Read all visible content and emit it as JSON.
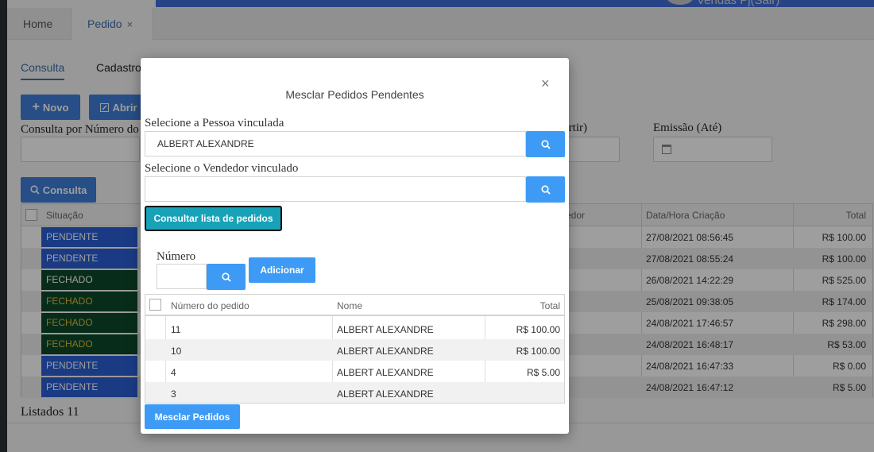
{
  "header": {
    "user_label": "Vendas Pj(Sair)"
  },
  "tabs": [
    {
      "label": "Home"
    },
    {
      "label": "Pedido",
      "close": "×"
    }
  ],
  "subtabs": [
    {
      "label": "Consulta"
    },
    {
      "label": "Cadastro"
    }
  ],
  "toolbar": {
    "novo_label": "Novo",
    "abrir_label": "Abrir",
    "consulta_label": "Consulta"
  },
  "filters": {
    "numero_label": "Consulta por Número do",
    "emissao_partir_label": "artir)",
    "emissao_ate_label": "Emissão (Até)"
  },
  "grid": {
    "columns": {
      "situacao": "Situação",
      "vendedor": "edor",
      "data_hora": "Data/Hora Criação",
      "total": "Total"
    },
    "rows": [
      {
        "situacao": "PENDENTE",
        "status_kind": "pendente",
        "data_hora": "27/08/2021 08:56:45",
        "total": "R$ 100.00"
      },
      {
        "situacao": "PENDENTE",
        "status_kind": "pendente",
        "data_hora": "27/08/2021 08:55:24",
        "total": "R$ 100.00"
      },
      {
        "situacao": "FECHADO",
        "status_kind": "fechado",
        "data_hora": "26/08/2021 14:22:29",
        "total": "R$ 525.00"
      },
      {
        "situacao": "FECHADO",
        "status_kind": "fechado-y",
        "data_hora": "25/08/2021 09:38:05",
        "total": "R$ 174.00"
      },
      {
        "situacao": "FECHADO",
        "status_kind": "fechado-y",
        "data_hora": "24/08/2021 17:46:57",
        "total": "R$ 298.00"
      },
      {
        "situacao": "FECHADO",
        "status_kind": "fechado-y",
        "data_hora": "24/08/2021 16:48:17",
        "total": "R$ 53.00"
      },
      {
        "situacao": "PENDENTE",
        "status_kind": "pendente",
        "data_hora": "24/08/2021 16:47:33",
        "total": "R$ 0.00"
      },
      {
        "situacao": "PENDENTE",
        "status_kind": "pendente",
        "data_hora": "24/08/2021 16:47:12",
        "total": "R$ 5.00"
      }
    ],
    "listed_label": "Listados 11"
  },
  "modal": {
    "title": "Mesclar Pedidos Pendentes",
    "close": "×",
    "pessoa_label": "Selecione a Pessoa vinculada",
    "pessoa_value": "ALBERT ALEXANDRE",
    "vendedor_label": "Selecione o Vendedor vinculado",
    "vendedor_value": "",
    "consultar_label": "Consultar lista de pedidos",
    "numero_label": "Número",
    "numero_value": "",
    "adicionar_label": "Adicionar",
    "table": {
      "columns": {
        "numero": "Número do pedido",
        "nome": "Nome",
        "total": "Total"
      },
      "rows": [
        {
          "numero": "11",
          "nome": "ALBERT ALEXANDRE",
          "total": "R$ 100.00"
        },
        {
          "numero": "10",
          "nome": "ALBERT ALEXANDRE",
          "total": "R$ 100.00"
        },
        {
          "numero": "4",
          "nome": "ALBERT ALEXANDRE",
          "total": "R$ 5.00"
        },
        {
          "numero": "3",
          "nome": "ALBERT ALEXANDRE",
          "total": ""
        }
      ]
    },
    "mesclar_label": "Mesclar Pedidos"
  },
  "colors": {
    "primary": "#3f7fd8",
    "modal_button": "#3d9bf5",
    "teal_button": "#17a2b8",
    "pendente": "#2a5fd6",
    "fechado": "#0c4a2b"
  }
}
